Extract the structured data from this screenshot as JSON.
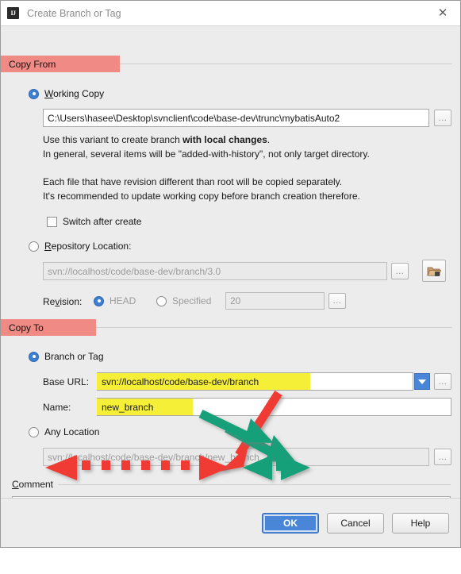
{
  "window": {
    "title": "Create Branch or Tag",
    "app_icon": "intellij-idea-icon",
    "close_icon": "close-icon"
  },
  "sections": {
    "copy_from": {
      "label": "Copy From",
      "highlight_color": "#ef8a85"
    },
    "copy_to": {
      "label": "Copy To",
      "highlight_color": "#ef8a85"
    }
  },
  "copy_from": {
    "working_copy": {
      "radio_label": "Working Copy",
      "selected": true,
      "path_value": "C:\\Users\\hasee\\Desktop\\svnclient\\code\\base-dev\\trunc\\mybatisAuto2",
      "browse_label": "...",
      "hint_line1_a": "Use this variant to create branch ",
      "hint_line1_b": "with local changes",
      "hint_line1_c": ".",
      "hint_line2": "In general, several items will be \"added-with-history\", not only target directory.",
      "hint_line3": "Each file that have revision different than root will be copied separately.",
      "hint_line4": "It's recommended to update working copy before branch creation therefore."
    },
    "switch_after_create": {
      "label": "Switch after create",
      "checked": false
    },
    "repository_location": {
      "radio_label": "Repository Location:",
      "selected": false,
      "url_value": "svn://localhost/code/base-dev/branch/3.0",
      "browse_label": "...",
      "folder_icon": "folder-repository-icon",
      "revision_label": "Revision:",
      "head_label": "HEAD",
      "head_selected": true,
      "specified_label": "Specified",
      "specified_selected": false,
      "revision_number": "20",
      "revision_browse_label": "..."
    }
  },
  "copy_to": {
    "branch_or_tag": {
      "radio_label": "Branch or Tag",
      "selected": true,
      "base_url_label": "Base URL:",
      "base_url_value": "svn://localhost/code/base-dev/branch",
      "base_url_browse_label": "...",
      "dropdown_icon": "chevron-down-icon",
      "name_label": "Name:",
      "name_value": "new_branch",
      "highlight_color": "#f5ef38"
    },
    "any_location": {
      "radio_label": "Any Location",
      "selected": false,
      "url_value": "svn://localhost/code/base-dev/branch/new_branch",
      "browse_label": "..."
    }
  },
  "comment": {
    "label": "Comment",
    "value": "",
    "placeholder": ""
  },
  "footer": {
    "ok_label": "OK",
    "cancel_label": "Cancel",
    "help_label": "Help"
  },
  "annotations": {
    "red_arrow_color": "#f03b36",
    "green_arrow_color": "#14a07a",
    "red_solid_arrow": "base-url-to-any-location-arrow",
    "green_solid_arrow": "name-to-any-location-arrow",
    "red_dashed_arrow": "any-location-path-prefix-arrow",
    "green_dashed_arrow": "any-location-path-suffix-arrow"
  }
}
